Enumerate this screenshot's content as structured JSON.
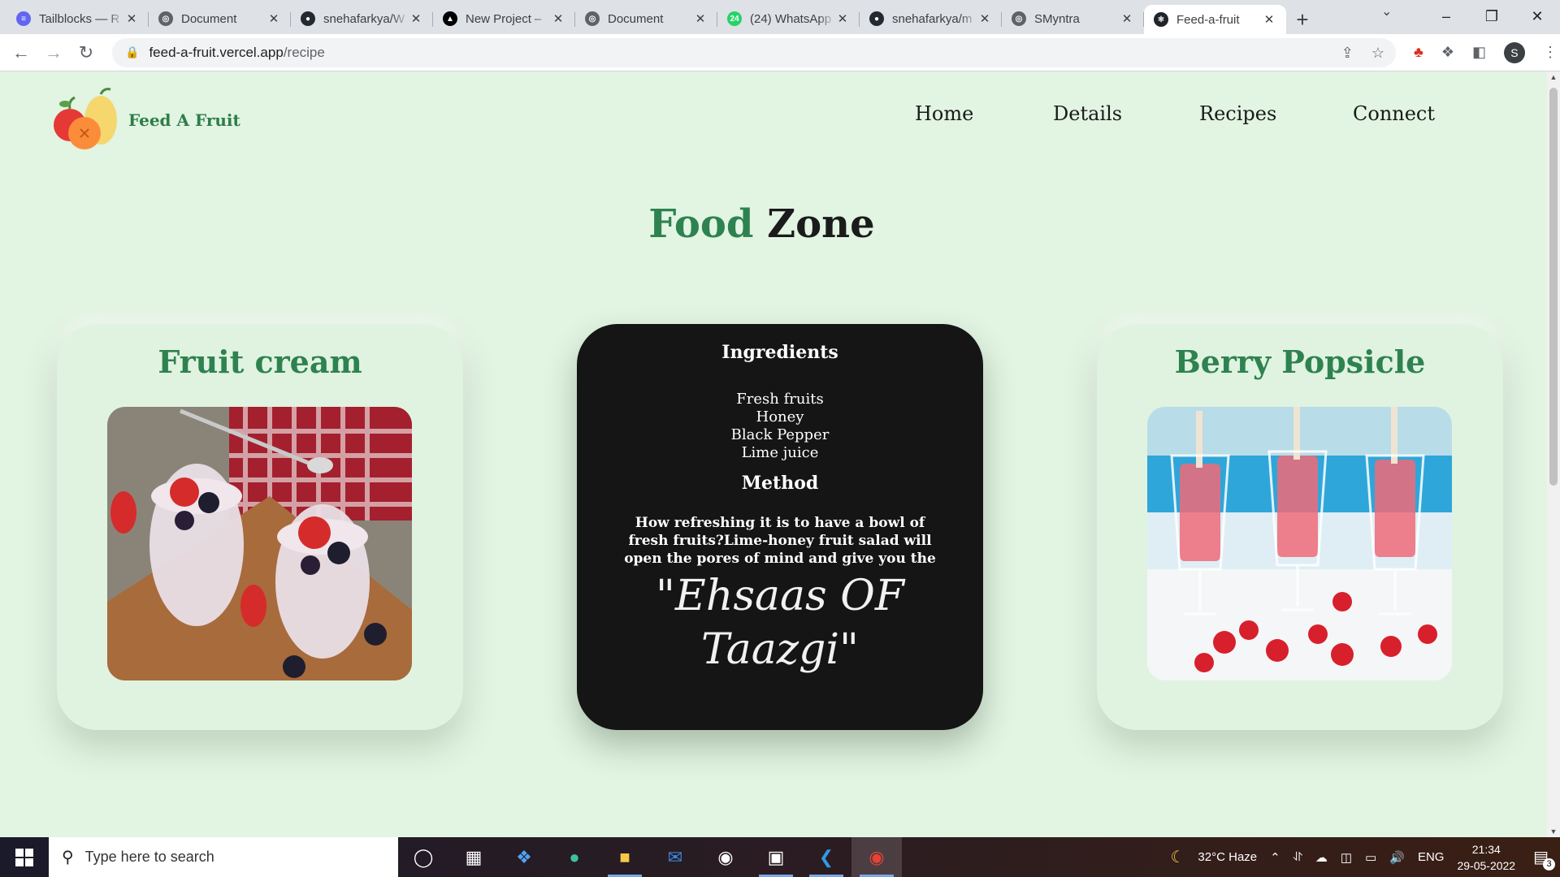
{
  "browser": {
    "tabs": [
      {
        "title": "Tailblocks — R",
        "color": "#6366f1",
        "glyph": "≡"
      },
      {
        "title": "Document",
        "color": "#5f6368",
        "glyph": "◎"
      },
      {
        "title": "snehafarkya/W",
        "color": "#24292f",
        "glyph": "●"
      },
      {
        "title": "New Project –",
        "color": "#000000",
        "glyph": "▲"
      },
      {
        "title": "Document",
        "color": "#5f6368",
        "glyph": "◎"
      },
      {
        "title": "(24) WhatsApp",
        "color": "#25d366",
        "glyph": "24"
      },
      {
        "title": "snehafarkya/m",
        "color": "#24292f",
        "glyph": "●"
      },
      {
        "title": "SMyntra",
        "color": "#5f6368",
        "glyph": "◎"
      },
      {
        "title": "Feed-a-fruit",
        "color": "#20232a",
        "glyph": "⚛"
      }
    ],
    "url_host": "feed-a-fruit.vercel.app",
    "url_path": "/recipe",
    "profile_initial": "S"
  },
  "site": {
    "logo_text": "Feed A Fruit",
    "nav": [
      "Home",
      "Details",
      "Recipes",
      "Connect"
    ],
    "heading_green": "Food",
    "heading_dark": "Zone"
  },
  "cards": {
    "left_title": "Fruit cream",
    "right_title": "Berry Popsicle",
    "middle": {
      "ingredients_title": "Ingredients",
      "ingredients": [
        "Fresh fruits",
        "Honey",
        "Black Pepper",
        "Lime juice"
      ],
      "method_title": "Method",
      "method_text": "How refreshing it is to have a bowl of fresh fruits?Lime-honey fruit salad will open the pores of mind and give you the",
      "quote": "\"Ehsaas OF Taazgi\""
    }
  },
  "taskbar": {
    "search_placeholder": "Type here to search",
    "weather": "32°C  Haze",
    "lang": "ENG",
    "time": "21:34",
    "date": "29-05-2022",
    "notifications": "3"
  }
}
